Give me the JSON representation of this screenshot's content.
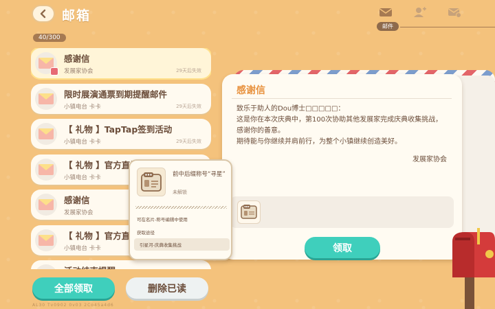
{
  "header": {
    "title": "邮箱",
    "count": "40/300",
    "tab_label": "邮件"
  },
  "mails": [
    {
      "title": "感谢信",
      "sender": "发展家协会",
      "expire": "29天后失效",
      "selected": true,
      "badge": true
    },
    {
      "title": "限时展演通票到期提醒邮件",
      "sender": "小镇电台 卡卡",
      "expire": "29天后失效"
    },
    {
      "title": "【 礼物 】TapTap签到活动",
      "sender": "小镇电台 卡卡",
      "expire": "29天后失效"
    },
    {
      "title": "【 礼物 】官方直播",
      "sender": "小镇电台 卡卡",
      "expire": ""
    },
    {
      "title": "感谢信",
      "sender": "发展家协会",
      "expire": ""
    },
    {
      "title": "【 礼物 】官方直",
      "sender": "小镇电台 卡卡",
      "expire": ""
    },
    {
      "title": "活动结束提醒",
      "sender": "",
      "expire": ""
    }
  ],
  "buttons": {
    "claim_all": "全部领取",
    "delete_read": "删除已读",
    "claim": "领取"
  },
  "footer": "AL30  Tv0902  0v03  2Co45a4d6",
  "letter": {
    "title": "感谢信",
    "greeting": "致乐于助人的Dou博士□□□□□：",
    "body1": "这是你在本次庆典中，第100次协助其他发展家完成庆典收集挑战，感谢你的善意。",
    "body2": "期待能与你继续并肩前行，为整个小镇继续创造美好。",
    "signature": "发展家协会"
  },
  "popup": {
    "name": "前中后缀称号“寻星”",
    "status": "未解锁",
    "usage": "可在名片-称号编辑中使用",
    "source_label": "获取途径",
    "source": "引星河-庆典收集挑战"
  },
  "colors": {
    "background": "#f4c27c",
    "accent_teal": "#3fcfbc",
    "letter_title": "#e8923f",
    "text_brown": "#6b4d3a"
  }
}
